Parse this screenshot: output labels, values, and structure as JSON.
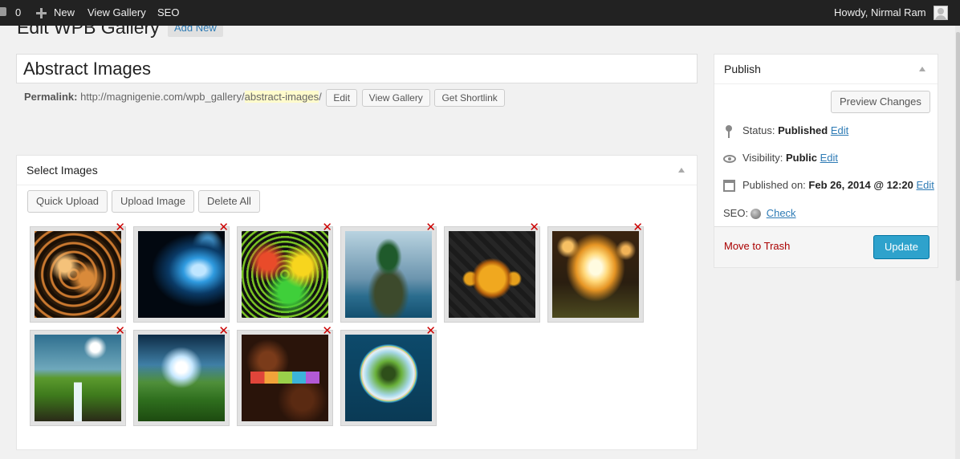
{
  "adminbar": {
    "comments_count": "0",
    "new_label": "New",
    "view_gallery_label": "View Gallery",
    "seo_label": "SEO",
    "howdy": "Howdy, Nirmal Ram"
  },
  "heading": {
    "title": "Edit WPB Gallery",
    "add_new": "Add New"
  },
  "post": {
    "title": "Abstract Images",
    "permalink_label": "Permalink:",
    "permalink_base": "http://magnigenie.com/wpb_gallery/",
    "permalink_slug": "abstract-images",
    "permalink_tail": "/",
    "edit_btn": "Edit",
    "view_gallery_btn": "View Gallery",
    "shortlink_btn": "Get Shortlink"
  },
  "select_images": {
    "title": "Select Images",
    "quick_upload": "Quick Upload",
    "upload_image": "Upload Image",
    "delete_all": "Delete All",
    "delete_symbol": "✕",
    "images": [
      {
        "name": "fractal-leopard"
      },
      {
        "name": "blue-skull"
      },
      {
        "name": "neon-leopard"
      },
      {
        "name": "island-tree"
      },
      {
        "name": "skull-headphones"
      },
      {
        "name": "light-bulbs"
      },
      {
        "name": "book-waterfall"
      },
      {
        "name": "valley-sun"
      },
      {
        "name": "inspire-typography"
      },
      {
        "name": "globe-tree"
      }
    ]
  },
  "publish": {
    "title": "Publish",
    "preview_btn": "Preview Changes",
    "status_label": "Status:",
    "status_value": "Published",
    "visibility_label": "Visibility:",
    "visibility_value": "Public",
    "published_label": "Published on:",
    "published_value": "Feb 26, 2014 @ 12:20",
    "edit_link": "Edit",
    "seo_label": "SEO:",
    "check_link": "Check",
    "trash": "Move to Trash",
    "update": "Update"
  },
  "colors": {
    "accent": "#2ea2cc",
    "link": "#2e7bb5",
    "danger": "#aa0000",
    "delete_x": "#cc0000"
  }
}
